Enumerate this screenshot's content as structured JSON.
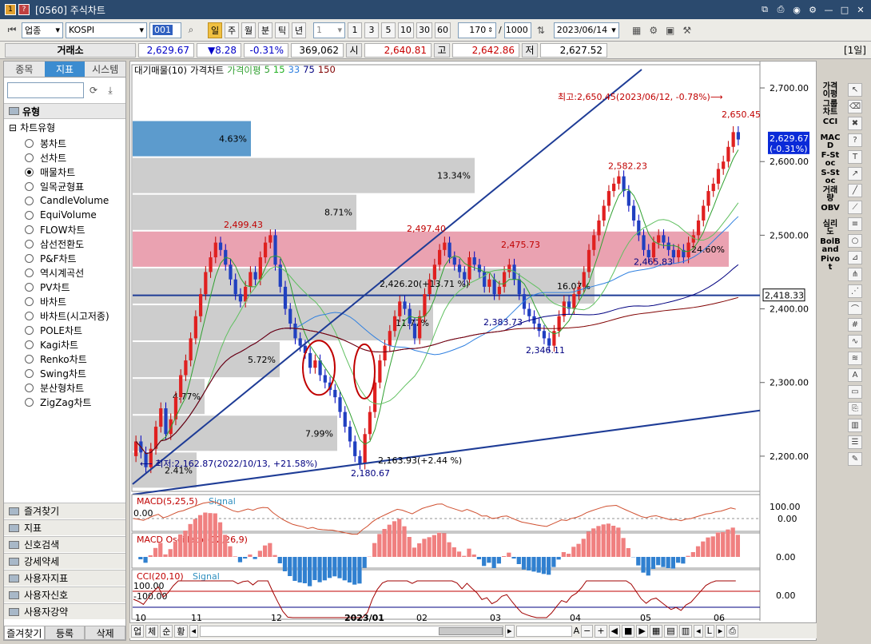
{
  "window": {
    "badge1": "1",
    "badge2": "?",
    "title": "[0560] 주식차트"
  },
  "toolbar": {
    "market": "업종",
    "symbol": "KOSPI",
    "code": "001",
    "period_buttons": [
      "일",
      "주",
      "월",
      "분",
      "틱",
      "년"
    ],
    "interval_select": "1",
    "intervals": [
      "1",
      "3",
      "5",
      "10",
      "30",
      "60"
    ],
    "count": "170",
    "count_sep": "/",
    "total": "1000",
    "date": "2023/06/14"
  },
  "quote": {
    "exchange": "거래소",
    "price": "2,629.67",
    "change": "▼8.28",
    "change_pct": "-0.31%",
    "volume": "369,062",
    "open_label": "시",
    "open": "2,640.81",
    "high_label": "고",
    "high": "2,642.86",
    "low_label": "저",
    "low": "2,627.52",
    "period": "[1일]"
  },
  "left": {
    "tabs": [
      "종목",
      "지표",
      "시스템"
    ],
    "section": "유형",
    "tree_root": "차트유형",
    "items": [
      "봉차트",
      "선차트",
      "매물차트",
      "일목균형표",
      "CandleVolume",
      "EquiVolume",
      "FLOW차트",
      "삼선전환도",
      "P&F차트",
      "역시계곡선",
      "PV차트",
      "바차트",
      "바차트(시고저종)",
      "POLE차트",
      "Kagi차트",
      "Renko차트",
      "Swing차트",
      "분산형차트",
      "ZigZag차트"
    ],
    "selected_index": 2,
    "bottom_sections": [
      "즐겨찾기",
      "지표",
      "신호검색",
      "강세약세",
      "사용자지표",
      "사용자신호",
      "사용자강약"
    ],
    "foot_tabs": [
      "즐겨찾기",
      "등록",
      "삭제"
    ]
  },
  "legend": {
    "item1": "대기매물(10)",
    "item2": "가격차트",
    "item3": "가격이평",
    "ma5": "5",
    "ma15": "15",
    "ma33": "33",
    "ma75": "75",
    "ma150": "150"
  },
  "chart_data": {
    "type": "candlestick",
    "y_ticks": [
      "2,700.00",
      "2,600.00",
      "2,500.00",
      "2,400.00",
      "2,300.00",
      "2,200.00"
    ],
    "ylim": [
      2150,
      2725
    ],
    "x_labels": [
      "10",
      "11",
      "12",
      "2023/01",
      "02",
      "03",
      "04",
      "05",
      "06"
    ],
    "current_price_label": "2,629.67",
    "current_change_label": "(-0.31%)",
    "hline_label": "2,418.33",
    "volume_profile_pct": [
      "4.63%",
      "13.34%",
      "8.71%",
      "24.60%",
      "16.07%",
      "11.77%",
      "5.72%",
      "4.77%",
      "7.99%",
      "2.41%"
    ],
    "annotations": {
      "high_note": "최고:2,650.45(2023/06/12, -0.78%)⟶",
      "low_note": "⟵ 최저:2,162.87(2022/10/13, +21.58%)",
      "p1": "2,499.43",
      "p2": "2,497.40",
      "p3": "2,475.73",
      "p4": "2,582.23",
      "p5": "2,650.45",
      "p6": "2,426.20(+13.71 %)",
      "p7": "2,383.73",
      "p8": "2,346.11",
      "p9": "2,465.83",
      "p10": "2,180.67",
      "p11": "2,163.93(+2.44 %)"
    }
  },
  "indicators": {
    "macd": {
      "name": "MACD(5,25,5)",
      "signal": "Signal",
      "zero": "0.00",
      "y_top": "100.00",
      "y_zero": "0.00"
    },
    "osc": {
      "name": "MACD Oscillator(12,26,9)",
      "y_zero": "0.00"
    },
    "cci": {
      "name": "CCI(20,10)",
      "signal": "Signal",
      "plus": "100.00",
      "minus": "-100.00",
      "y_zero": "0.00"
    }
  },
  "right_indicators": [
    "가격이평",
    "그룹차트",
    "CCI",
    "MACD",
    "F-Stoc",
    "S-Stoc",
    "거래량",
    "OBV",
    "심리도",
    "BolBand",
    "Pivot"
  ],
  "scrollbar": {
    "tabs": [
      "업",
      "체",
      "순",
      "황"
    ],
    "zoom": "A"
  }
}
